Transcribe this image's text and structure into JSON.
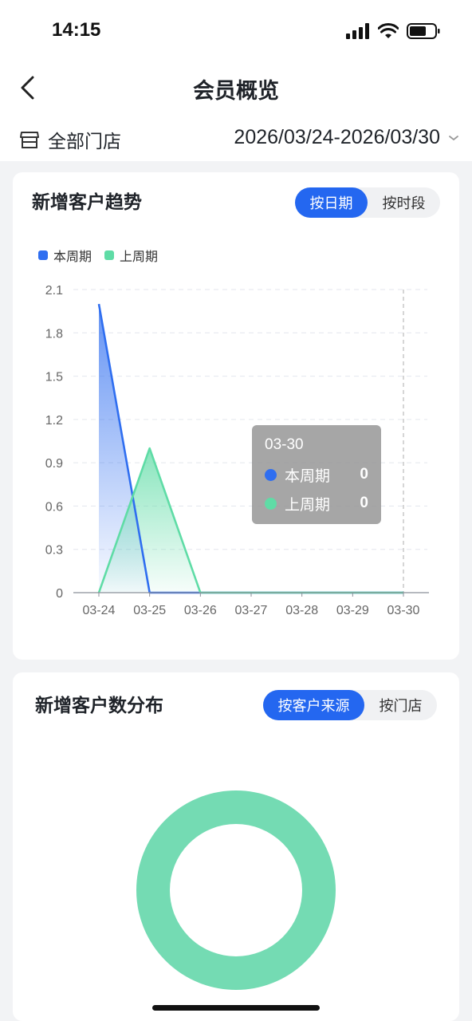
{
  "status": {
    "time": "14:15"
  },
  "nav": {
    "title": "会员概览"
  },
  "filters": {
    "store": "全部门店",
    "date_range": "2026/03/24-2026/03/30"
  },
  "trend": {
    "title": "新增客户趋势",
    "tabs": [
      {
        "label": "按日期",
        "active": true
      },
      {
        "label": "按时段",
        "active": false
      }
    ],
    "tooltip": {
      "date": "03-30",
      "rows": [
        {
          "name": "本周期",
          "value": "0"
        },
        {
          "name": "上周期",
          "value": "0"
        }
      ]
    }
  },
  "distribution": {
    "title": "新增客户数分布",
    "tabs": [
      {
        "label": "按客户来源",
        "active": true
      },
      {
        "label": "按门店",
        "active": false
      }
    ]
  },
  "colors": {
    "accent": "#2467f0",
    "current": "#2f6ef0",
    "previous": "#5fdca6",
    "donut": "#74dbb3"
  },
  "chart_data": [
    {
      "type": "area",
      "categories": [
        "03-24",
        "03-25",
        "03-26",
        "03-27",
        "03-28",
        "03-29",
        "03-30"
      ],
      "yticks": [
        "0",
        "0.3",
        "0.6",
        "0.9",
        "1.2",
        "1.5",
        "1.8",
        "2.1"
      ],
      "ylim": [
        0,
        2.1
      ],
      "grid": true,
      "legend_position": "top-left",
      "series": [
        {
          "name": "本周期",
          "color": "#2f6ef0",
          "values": [
            2,
            0,
            0,
            0,
            0,
            0,
            0
          ]
        },
        {
          "name": "上周期",
          "color": "#5fdca6",
          "values": [
            0,
            1,
            0,
            0,
            0,
            0,
            0
          ]
        }
      ],
      "highlight_category": "03-30"
    },
    {
      "type": "pie",
      "donut": true,
      "slices": [
        {
          "value": 1,
          "color": "#74dbb3"
        }
      ]
    }
  ]
}
